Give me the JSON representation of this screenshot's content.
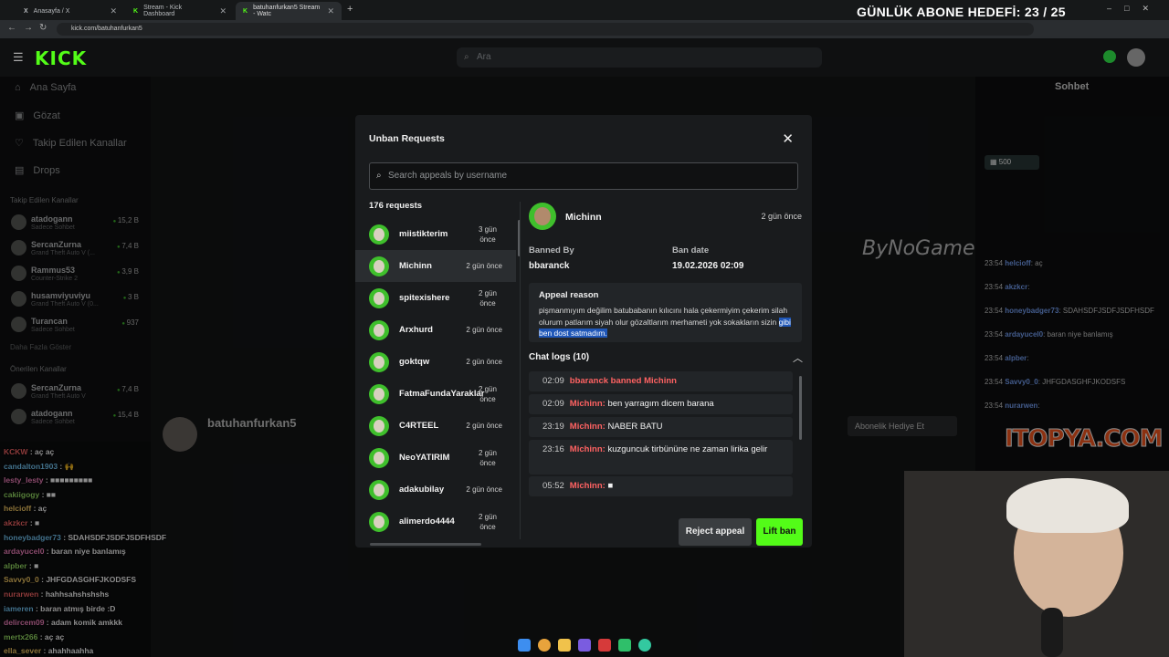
{
  "overlay": {
    "goal_text": "GÜNLÜK ABONE HEDEFİ: 23 / 25",
    "sponsor": "ITOPYA.COM",
    "brand": "ByNoGame"
  },
  "browser": {
    "tabs": [
      {
        "label": "Anasayfa / X"
      },
      {
        "label": "Stream - Kick Dashboard"
      },
      {
        "label": "batuhanfurkan5 Stream - Watc"
      }
    ],
    "url": "kick.com/batuhanfurkan5"
  },
  "kick": {
    "logo": "KICK",
    "search_placeholder": "Ara",
    "nav": [
      "Ana Sayfa",
      "Gözat",
      "Takip Edilen Kanallar",
      "Drops"
    ],
    "followed_title": "Takip Edilen Kanallar",
    "followed": [
      {
        "name": "atadogann",
        "sub": "Sadece Sohbet",
        "viewers": "15,2 B"
      },
      {
        "name": "SercanZurna",
        "sub": "Grand Theft Auto V (...",
        "viewers": "7,4 B"
      },
      {
        "name": "Rammus53",
        "sub": "Counter-Strike 2",
        "viewers": "3,9 B"
      },
      {
        "name": "husamviyuviyu",
        "sub": "Grand Theft Auto V (0...",
        "viewers": "3 B"
      },
      {
        "name": "Turancan",
        "sub": "Sadece Sohbet",
        "viewers": "937"
      }
    ],
    "show_more": "Daha Fazla Göster",
    "recommended_title": "Önerilen Kanallar",
    "recommended": [
      {
        "name": "SercanZurna",
        "sub": "Grand Theft Auto V",
        "viewers": "7,4 B"
      },
      {
        "name": "atadogann",
        "sub": "Sadece Sohbet",
        "viewers": "15,4 B"
      }
    ],
    "streamer": "batuhanfurkan5",
    "rchat_title": "Sohbet",
    "gift_button": "Abonelik Hediye Et"
  },
  "left_chat": [
    {
      "user": "KCKW",
      "msg": "aç aç"
    },
    {
      "user": "candalton1903",
      "msg": "🙌"
    },
    {
      "user": "lesty_lesty",
      "msg": "■■■■■■■■■"
    },
    {
      "user": "cakiigogy",
      "msg": "■■"
    },
    {
      "user": "helcioff",
      "msg": "aç"
    },
    {
      "user": "akzkcr",
      "msg": "■"
    },
    {
      "user": "honeybadger73",
      "msg": "SDAHSDFJSDFJSDFHSDF"
    },
    {
      "user": "ardayucel0",
      "msg": "baran niye banlamış"
    },
    {
      "user": "alpber",
      "msg": "■"
    },
    {
      "user": "Savvy0_0",
      "msg": "JHFGDASGHFJKODSFS"
    },
    {
      "user": "nurarwen",
      "msg": "hahhsahshshshs"
    },
    {
      "user": "iameren",
      "msg": "baran atmış birde :D"
    },
    {
      "user": "delircem09",
      "msg": "adam komik amkkk"
    },
    {
      "user": "mertx266",
      "msg": "aç aç"
    },
    {
      "user": "ella_sever",
      "msg": "ahahhaahha"
    }
  ],
  "right_chat": [
    {
      "time": "23:54",
      "user": "helcioff",
      "msg": "aç"
    },
    {
      "time": "23:54",
      "user": "akzkcr",
      "msg": ""
    },
    {
      "time": "23:54",
      "user": "honeybadger73",
      "msg": "SDAHSDFJSDFJSDFHSDF"
    },
    {
      "time": "23:54",
      "user": "ardayucel0",
      "msg": "baran niye banlamış"
    },
    {
      "time": "23:54",
      "user": "alpber",
      "msg": ""
    },
    {
      "time": "23:54",
      "user": "Savvy0_0",
      "msg": "JHFGDASGHFJKODSFS"
    },
    {
      "time": "23:54",
      "user": "nurarwen",
      "msg": ""
    }
  ],
  "modal": {
    "title": "Unban Requests",
    "search_placeholder": "Search appeals by username",
    "count_label": "176 requests",
    "requests": [
      {
        "name": "miistikterim",
        "time": "3 gün önce"
      },
      {
        "name": "Michinn",
        "time": "2 gün önce"
      },
      {
        "name": "spitexishere",
        "time": "2 gün önce"
      },
      {
        "name": "Arxhurd",
        "time": "2 gün önce"
      },
      {
        "name": "goktqw",
        "time": "2 gün önce"
      },
      {
        "name": "FatmaFundaYaraklar",
        "time": "2 gün önce"
      },
      {
        "name": "C4RTEEL",
        "time": "2 gün önce"
      },
      {
        "name": "NeoYATIRIM",
        "time": "2 gün önce"
      },
      {
        "name": "adakubilay",
        "time": "2 gün önce"
      },
      {
        "name": "alimerdo4444",
        "time": "2 gün önce"
      }
    ],
    "detail": {
      "name": "Michinn",
      "time": "2 gün önce",
      "banned_by_label": "Banned By",
      "banned_by": "bbaranck",
      "ban_date_label": "Ban date",
      "ban_date": "19.02.2026 02:09",
      "appeal_title": "Appeal reason",
      "appeal_text_a": "pişmanmıyım değilim batubabanın kılıcını hala çekermiyim çekerim silah olurum patlarım siyah olur gözaltlarım merhameti yok sokakların sizin ",
      "appeal_text_b": "gibi ben dost satmadım.",
      "chatlogs_title": "Chat logs (10)",
      "logs": [
        {
          "time": "02:09",
          "user": "",
          "msg": "bbaranck banned Michinn"
        },
        {
          "time": "02:09",
          "user": "Michinn:",
          "msg": "ben yarragım dicem barana"
        },
        {
          "time": "23:19",
          "user": "Michinn:",
          "msg": "NABER BATU"
        },
        {
          "time": "23:16",
          "user": "Michinn:",
          "msg": "kuzguncuk tirbününe ne zaman lirika gelir"
        },
        {
          "time": "05:52",
          "user": "Michinn:",
          "msg": "■"
        }
      ]
    },
    "reject_label": "Reject appeal",
    "lift_label": "Lift ban"
  },
  "colors": {
    "kick_green": "#53fc18",
    "username_red": "#ff6262",
    "modal_bg": "#191b1d"
  }
}
